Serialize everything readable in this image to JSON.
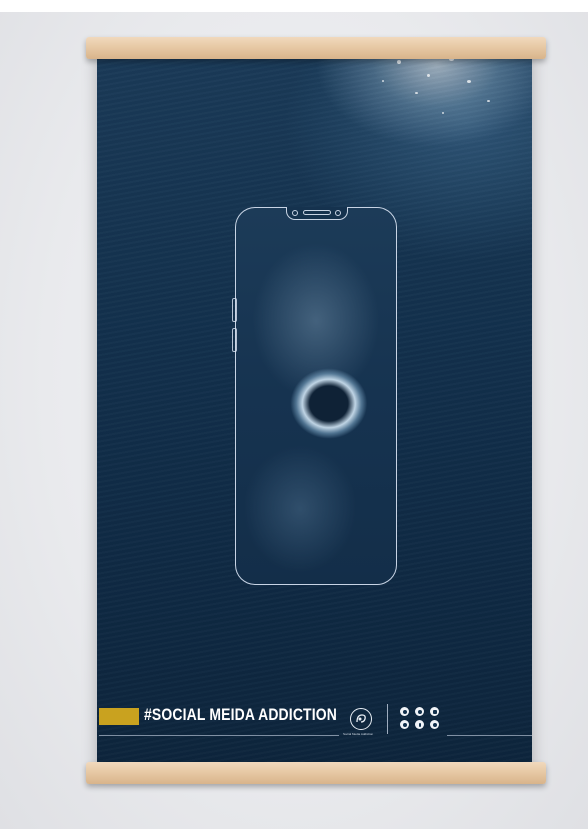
{
  "hashtag_text": "#SOCIAL MEIDA ADDICTION",
  "logo_caption": "Social Media Addiction",
  "colors": {
    "poster_bg": "#12304c",
    "accent_gold": "#c9a21f",
    "frame_wood": "#e7c9a5",
    "phone_outline": "#dce6f5"
  },
  "social_icons": [
    "instagram-icon",
    "whatsapp-icon",
    "youtube-icon",
    "twitter-icon",
    "facebook-icon",
    "instagram-alt-icon"
  ]
}
